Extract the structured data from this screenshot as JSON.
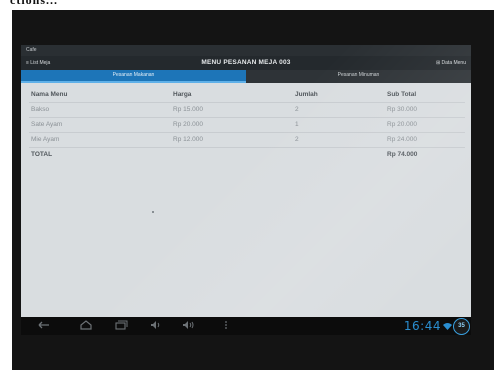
{
  "caption": "ctions...",
  "statusbar": {
    "app_title": "Cafe"
  },
  "actionbar": {
    "left_label": "≡  List Meja",
    "title": "MENU PESANAN MEJA 003",
    "right_label": "⊞  Data Menu"
  },
  "tabs": [
    {
      "label": "Pesanan Makanan",
      "active": true
    },
    {
      "label": "Pesanan Minuman",
      "active": false
    }
  ],
  "table": {
    "headers": [
      "Nama Menu",
      "Harga",
      "Jumlah",
      "Sub Total"
    ],
    "rows": [
      [
        "Bakso",
        "Rp 15.000",
        "2",
        "Rp 30.000"
      ],
      [
        "Sate Ayam",
        "Rp 20.000",
        "1",
        "Rp 20.000"
      ],
      [
        "Mie Ayam",
        "Rp 12.000",
        "2",
        "Rp 24.000"
      ]
    ],
    "total_label": "TOTAL",
    "total_value": "Rp 74.000"
  },
  "systembar": {
    "icons": [
      "back-icon",
      "home-icon",
      "recent-apps-icon",
      "volume-down-icon",
      "volume-up-icon",
      "overflow-menu-icon"
    ],
    "clock": "16:44",
    "notification_count": "35",
    "accent_color": "#2a8ed0"
  }
}
